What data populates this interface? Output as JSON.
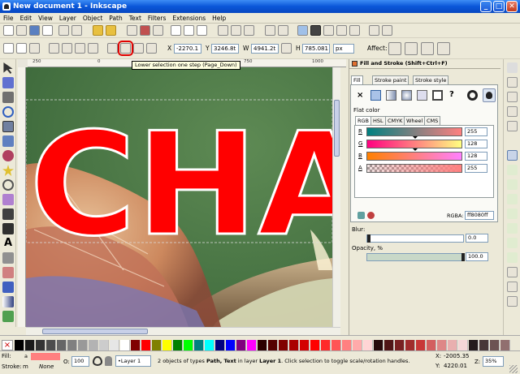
{
  "window": {
    "title": "New document 1 - Inkscape",
    "minimize_glyph": "_",
    "maximize_glyph": "□",
    "close_glyph": "✕"
  },
  "menu": [
    "File",
    "Edit",
    "View",
    "Layer",
    "Object",
    "Path",
    "Text",
    "Filters",
    "Extensions",
    "Help"
  ],
  "toolbar": {
    "x_label": "X",
    "x_value": "-2270.1",
    "y_label": "Y",
    "y_value": "3246.8t",
    "w_label": "W",
    "w_value": "4941.2t",
    "h_label": "H",
    "h_value": "785.081",
    "unit": "px",
    "affect_label": "Affect:",
    "tooltip": "Lower selection one step (Page_Down)"
  },
  "ruler": {
    "tick_250": "250",
    "tick_0": "0",
    "tick_750": "750",
    "tick_1000": "1000"
  },
  "canvas": {
    "text": "CHA"
  },
  "fill_stroke": {
    "title": "Fill and Stroke (Shift+Ctrl+F)",
    "tabs": [
      "Fill",
      "Stroke paint",
      "Stroke style"
    ],
    "paint_x": "×",
    "paint_unknown": "?",
    "flat_color_label": "Flat color",
    "color_tabs": [
      "RGB",
      "HSL",
      "CMYK",
      "Wheel",
      "CMS"
    ],
    "channels": [
      {
        "label": "R",
        "value": "255"
      },
      {
        "label": "G",
        "value": "128"
      },
      {
        "label": "B",
        "value": "128"
      },
      {
        "label": "A",
        "value": "255"
      }
    ],
    "rgba_label": "RGBA:",
    "rgba_value": "ff8080ff",
    "blur_label": "Blur:",
    "blur_value": "0.0",
    "opacity_label": "Opacity, %",
    "opacity_value": "100.0",
    "blur_level": 0,
    "opacity_level": 1.0
  },
  "status": {
    "fill_label": "Fill:",
    "fill_value": "a",
    "stroke_label": "Stroke:",
    "stroke_unit": "m",
    "stroke_value": "None",
    "opacity_label": "O:",
    "opacity_value": "100",
    "layer": "•Layer 1",
    "message_pre": "2 objects of types ",
    "message_types": "Path, Text",
    "message_mid": " in layer ",
    "message_layer": "Layer 1",
    "message_post": ". Click selection to toggle scale/rotation handles.",
    "x_label": "X:",
    "x_value": "-2005.35",
    "y_label": "Y:",
    "y_value": "4220.01",
    "zoom_label": "Z:",
    "zoom_value": "35%"
  },
  "colors": {
    "accent_highlight": "#e00000",
    "fill_color": "#ff8080",
    "canvas_bg": "#4d7a48",
    "text_red": "#ff0000"
  }
}
